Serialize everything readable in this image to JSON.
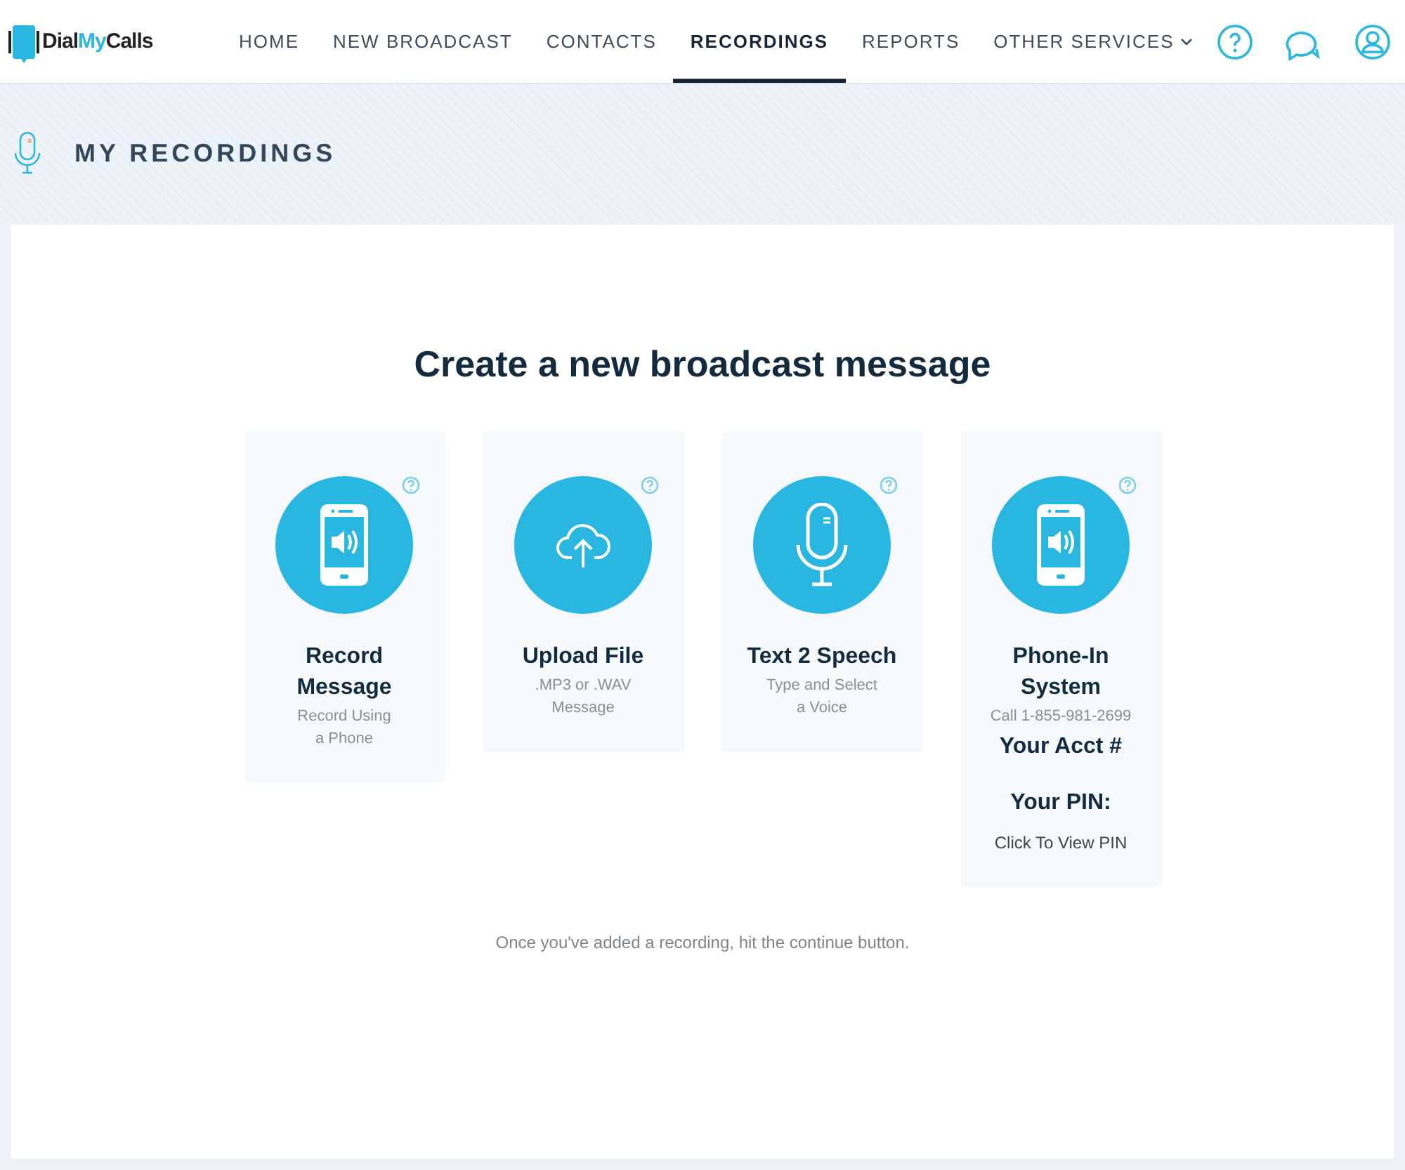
{
  "logo": {
    "parts": [
      "Dial",
      "My",
      "Calls"
    ]
  },
  "nav": [
    {
      "label": "HOME",
      "selected": false,
      "dropdown": false
    },
    {
      "label": "NEW BROADCAST",
      "selected": false,
      "dropdown": false
    },
    {
      "label": "CONTACTS",
      "selected": false,
      "dropdown": false
    },
    {
      "label": "RECORDINGS",
      "selected": true,
      "dropdown": false
    },
    {
      "label": "REPORTS",
      "selected": false,
      "dropdown": false
    },
    {
      "label": "OTHER SERVICES",
      "selected": false,
      "dropdown": true
    }
  ],
  "page_title": "MY RECORDINGS",
  "heading": "Create a new broadcast message",
  "cards": [
    {
      "kind": "phone",
      "title": [
        "Record",
        "Message"
      ],
      "subtitle": [
        "Record Using",
        "a Phone"
      ]
    },
    {
      "kind": "cloud",
      "title": [
        "Upload File"
      ],
      "subtitle": [
        ".MP3 or .WAV",
        "Message"
      ]
    },
    {
      "kind": "mic",
      "title": [
        "Text 2 Speech"
      ],
      "subtitle": [
        "Type and Select",
        "a Voice"
      ]
    },
    {
      "kind": "phone",
      "title": [
        "Phone-In",
        "System"
      ],
      "subtitle": [
        "Call 1-855-981-2699"
      ],
      "details": [
        {
          "kind": "label",
          "text": "Your Acct #"
        },
        {
          "kind": "label",
          "text": "Your PIN:"
        },
        {
          "kind": "link",
          "text": "Click To View PIN"
        }
      ]
    }
  ],
  "footer_note": "Once you've added a recording, hit the continue button."
}
